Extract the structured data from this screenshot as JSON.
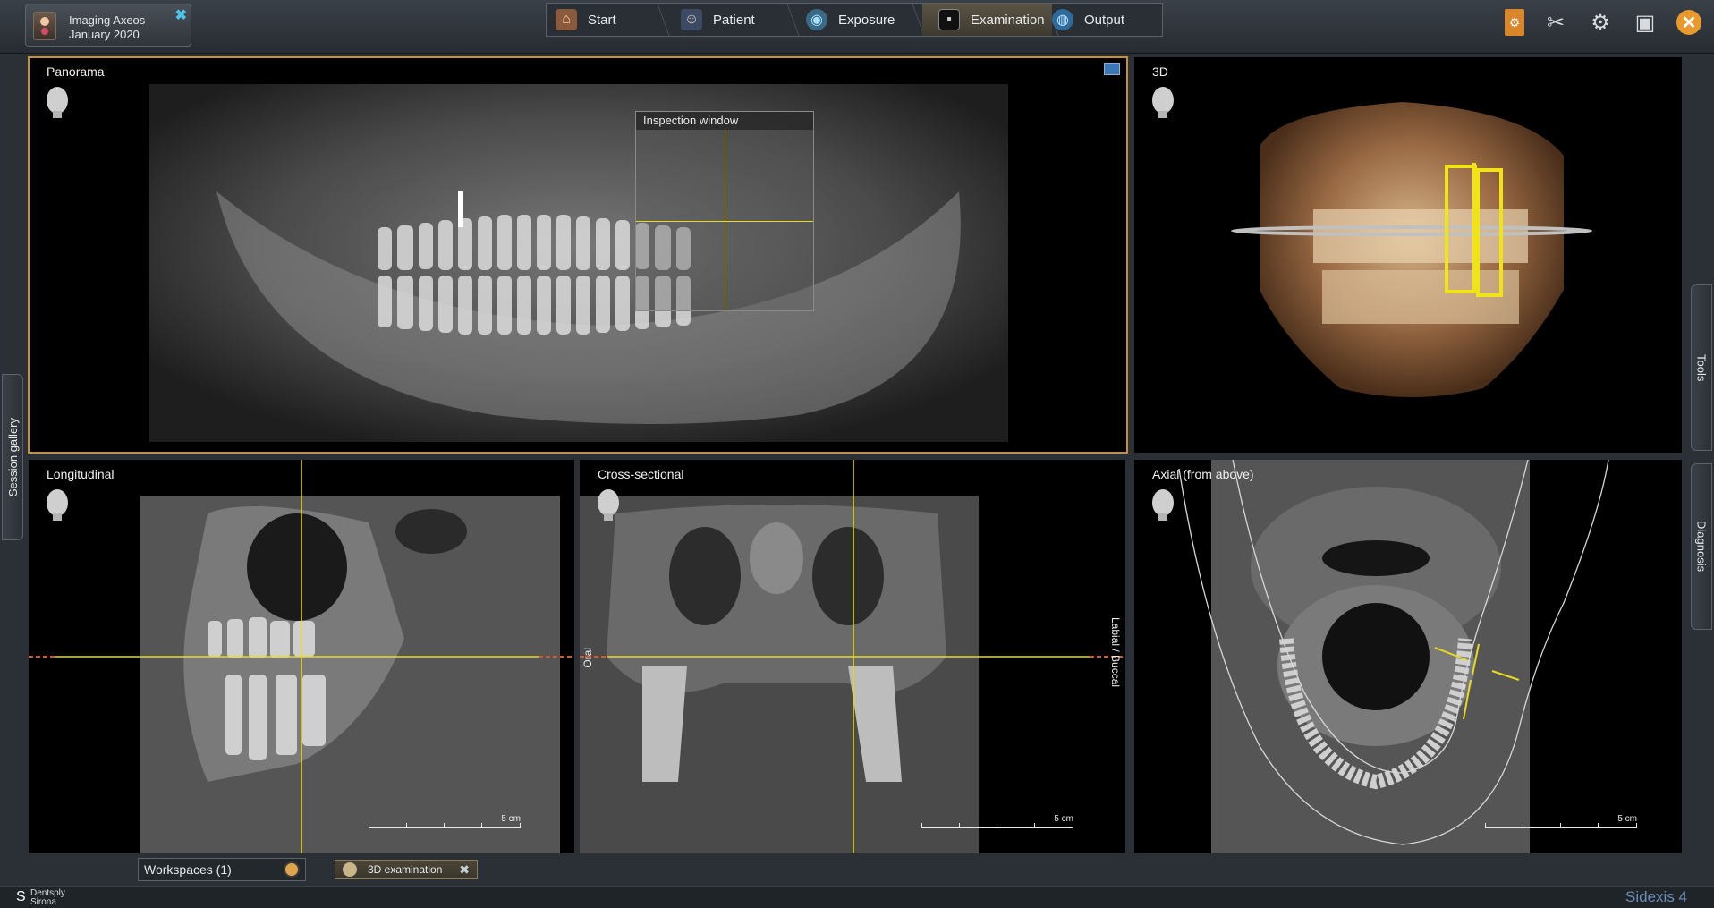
{
  "patient": {
    "name": "Imaging Axeos",
    "date": "January 2020"
  },
  "workflow": [
    {
      "label": "Start",
      "icon": "home-icon"
    },
    {
      "label": "Patient",
      "icon": "patient-icon"
    },
    {
      "label": "Exposure",
      "icon": "exposure-icon"
    },
    {
      "label": "Examination",
      "icon": "examination-icon",
      "active": true
    },
    {
      "label": "Output",
      "icon": "output-icon"
    }
  ],
  "views": {
    "panorama": {
      "label": "Panorama",
      "inspection": "Inspection window"
    },
    "three_d": {
      "label": "3D"
    },
    "longitudinal": {
      "label": "Longitudinal",
      "scale": "5 cm"
    },
    "cross_sectional": {
      "label": "Cross-sectional",
      "scale": "5 cm",
      "left_side": "Oral",
      "right_side": "Labial / Buccal"
    },
    "axial": {
      "label": "Axial (from above)",
      "scale": "5 cm"
    }
  },
  "side_tabs": {
    "session_gallery": "Session gallery",
    "tools": "Tools",
    "diagnosis": "Diagnosis"
  },
  "bottom": {
    "workspaces": "Workspaces (1)",
    "exam_tab": "3D examination"
  },
  "footer": {
    "brand_line1": "Dentsply",
    "brand_line2": "Sirona",
    "product": "Sidexis 4"
  },
  "colors": {
    "accent": "#c7922e",
    "crosshair": "#e8dc1c"
  }
}
